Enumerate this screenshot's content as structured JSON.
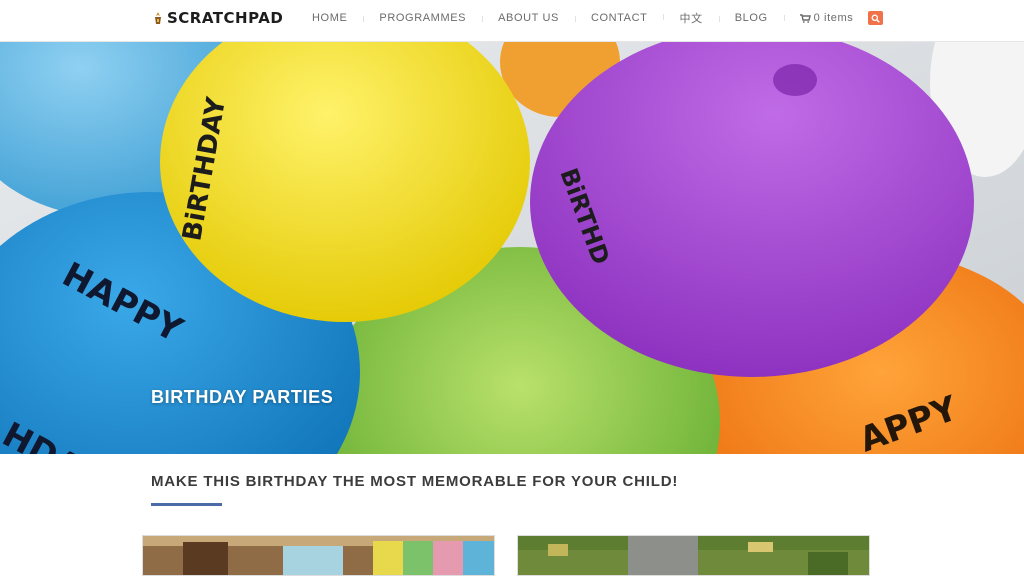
{
  "header": {
    "logo_text": "SCRATCHPAD",
    "nav": [
      {
        "label": "HOME"
      },
      {
        "label": "PROGRAMMES"
      },
      {
        "label": "ABOUT US"
      },
      {
        "label": "CONTACT"
      },
      {
        "label": "中文"
      },
      {
        "label": "BLOG"
      }
    ],
    "cart_label": "0 items",
    "cart_icon": "shopping-cart-icon",
    "search_icon": "search-icon",
    "accent_color": "#f0724a"
  },
  "hero": {
    "title": "BIRTHDAY PARTIES",
    "image": "birthday-balloons-photo"
  },
  "main": {
    "heading": "MAKE THIS BIRTHDAY THE MOST MEMORABLE FOR YOUR CHILD!",
    "rule_color": "#4b6aa8",
    "cards": [
      {
        "image": "minecraft-room-screenshot"
      },
      {
        "image": "minecraft-landscape-screenshot"
      }
    ]
  }
}
